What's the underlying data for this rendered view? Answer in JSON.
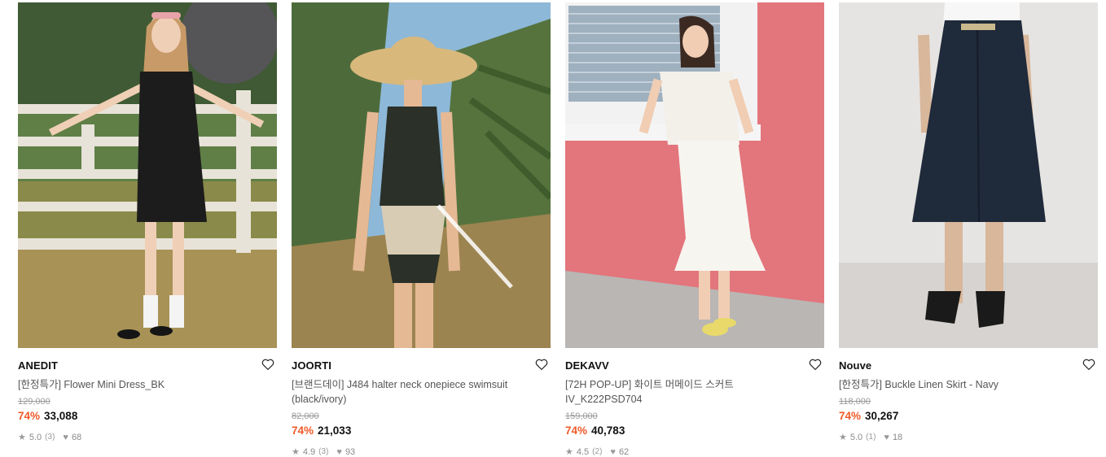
{
  "products": [
    {
      "brand": "ANEDIT",
      "name": "[한정특가] Flower Mini Dress_BK",
      "original_price": "129,000",
      "discount": "74%",
      "price": "33,088",
      "rating": "5.0",
      "review_count": "(3)",
      "likes": "68"
    },
    {
      "brand": "JOORTI",
      "name": "[브랜드데이] J484 halter neck onepiece swimsuit (black/ivory)",
      "original_price": "82,000",
      "discount": "74%",
      "price": "21,033",
      "rating": "4.9",
      "review_count": "(3)",
      "likes": "93"
    },
    {
      "brand": "DEKAVV",
      "name": "[72H POP-UP] 화이트 머메이드 스커트 IV_K222PSD704",
      "original_price": "159,000",
      "discount": "74%",
      "price": "40,783",
      "rating": "4.5",
      "review_count": "(2)",
      "likes": "62"
    },
    {
      "brand": "Nouve",
      "name": "[한정특가] Buckle Linen Skirt - Navy",
      "original_price": "118,000",
      "discount": "74%",
      "price": "30,267",
      "rating": "5.0",
      "review_count": "(1)",
      "likes": "18"
    }
  ],
  "icons": {
    "wishlist": "heart-outline-icon",
    "rating": "star-icon",
    "likes": "heart-filled-icon"
  },
  "colors": {
    "discount": "#f05a28",
    "muted": "#9a9a9a"
  }
}
